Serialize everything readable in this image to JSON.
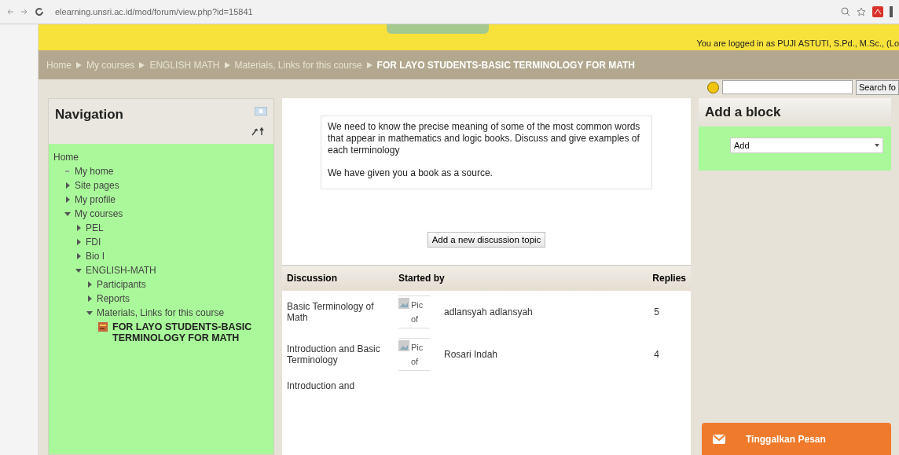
{
  "browser": {
    "url": "elearning.unsri.ac.id/mod/forum/view.php?id=15841"
  },
  "header": {
    "login_text": "You are logged in as PUJI ASTUTI, S.Pd., M.Sc., (Lo"
  },
  "breadcrumb": [
    {
      "label": "Home",
      "current": false
    },
    {
      "label": "My courses",
      "current": false
    },
    {
      "label": "ENGLISH MATH",
      "current": false
    },
    {
      "label": "Materials, Links for this course",
      "current": false
    },
    {
      "label": "FOR LAYO STUDENTS-BASIC TERMINOLOGY FOR MATH",
      "current": true
    }
  ],
  "search": {
    "button": "Search fo"
  },
  "navigation": {
    "title": "Navigation",
    "items": [
      {
        "label": "Home",
        "children": [
          {
            "label": "My home",
            "kind": "bullet"
          },
          {
            "label": "Site pages",
            "kind": "branch",
            "expanded": false
          },
          {
            "label": "My profile",
            "kind": "branch",
            "expanded": false
          },
          {
            "label": "My courses",
            "kind": "branch",
            "expanded": true,
            "children": [
              {
                "label": "PEL",
                "kind": "branch",
                "expanded": false
              },
              {
                "label": "FDI",
                "kind": "branch",
                "expanded": false
              },
              {
                "label": "Bio I",
                "kind": "branch",
                "expanded": false
              },
              {
                "label": "ENGLISH-MATH",
                "kind": "branch",
                "expanded": true,
                "children": [
                  {
                    "label": "Participants",
                    "kind": "branch",
                    "expanded": false
                  },
                  {
                    "label": "Reports",
                    "kind": "branch",
                    "expanded": false
                  },
                  {
                    "label": "Materials, Links for this course",
                    "kind": "branch",
                    "expanded": true,
                    "children": [
                      {
                        "label": "FOR LAYO STUDENTS-BASIC TERMINOLOGY FOR MATH",
                        "kind": "forum"
                      }
                    ]
                  }
                ]
              }
            ]
          }
        ]
      }
    ]
  },
  "intro": [
    "We need to know the precise meaning of some of the most common words that appear in mathematics and logic books. Discuss and give examples of each terminology",
    "We have given you a book as a source."
  ],
  "add_topic_button": "Add a new discussion topic",
  "table": {
    "columns": [
      "Discussion",
      "Started by",
      "Replies"
    ],
    "rows": [
      {
        "discussion": "Basic Terminology of Math",
        "picture_alt": "Pic of",
        "started_by": "adlansyah adlansyah",
        "replies": "5"
      },
      {
        "discussion": "Introduction and Basic Terminology",
        "picture_alt": "Pic of",
        "started_by": "Rosari Indah",
        "replies": "4"
      },
      {
        "discussion": "Introduction and"
      }
    ]
  },
  "add_block": {
    "title": "Add a block",
    "select_value": "Add"
  },
  "chat_button": "Tinggalkan Pesan"
}
